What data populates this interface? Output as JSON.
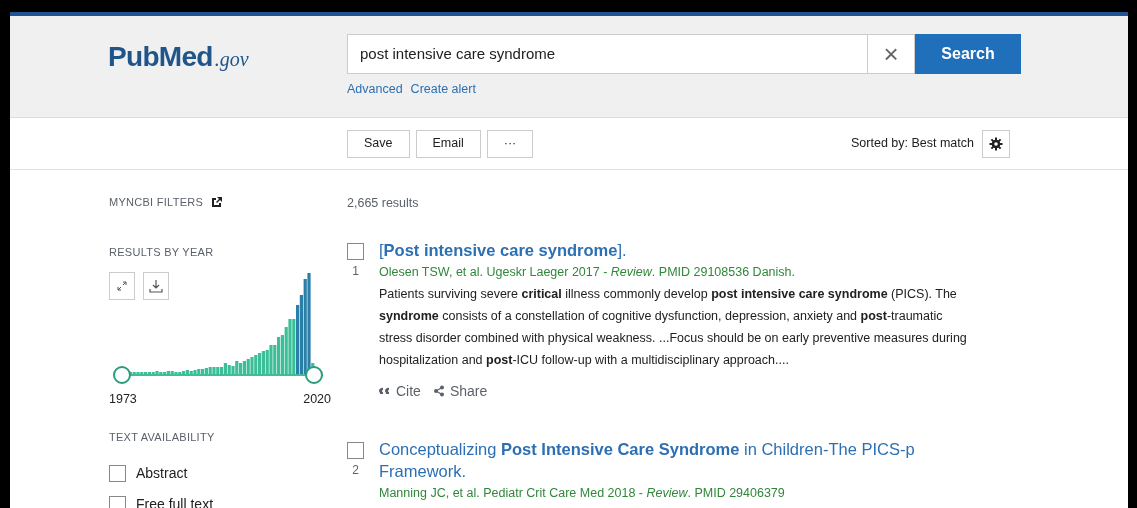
{
  "header": {
    "logo": {
      "main": "PubMed",
      "suffix": ".gov"
    },
    "search": {
      "value": "post intensive care syndrome",
      "clear": "×",
      "button": "Search"
    },
    "links": [
      "Advanced",
      "Create alert"
    ]
  },
  "toolbar": {
    "buttons": [
      "Save",
      "Email",
      "···"
    ],
    "sort_label": "Sorted by: Best match"
  },
  "sidebar": {
    "myncbi": "MYNCBI FILTERS",
    "results_by_year": "RESULTS BY YEAR",
    "year_start": "1973",
    "year_end": "2020",
    "text_availability": "TEXT AVAILABILITY",
    "filters": [
      {
        "label": "Abstract",
        "checked": false
      },
      {
        "label": "Free full text",
        "checked": false
      }
    ]
  },
  "results_count": "2,665 results",
  "results": [
    {
      "number": "1",
      "checked": false,
      "title": "[**Post intensive care syndrome**].",
      "citation": "Olesen TSW, et al. Ugeskr Laeger 2017 - *Review*. PMID 29108536 Danish.",
      "snippet": "Patients surviving severe **critical** illness commonly develop **post intensive care syndrome** (PICS). The **syndrome** consists of a constellation of cognitive dysfunction, depression, anxiety and **post**-traumatic stress disorder combined with physical weakness. ...Focus should be on early preventive measures during hospitalization and **post**-ICU follow-up with a multidisciplinary approach....",
      "actions": [
        "Cite",
        "Share"
      ]
    },
    {
      "number": "2",
      "checked": false,
      "title": "Conceptualizing **Post Intensive Care Syndrome** in Children-The PICS-p Framework.",
      "citation": "Manning JC, et al. Pediatr Crit Care Med 2018 - *Review*. PMID 29406379"
    }
  ]
}
